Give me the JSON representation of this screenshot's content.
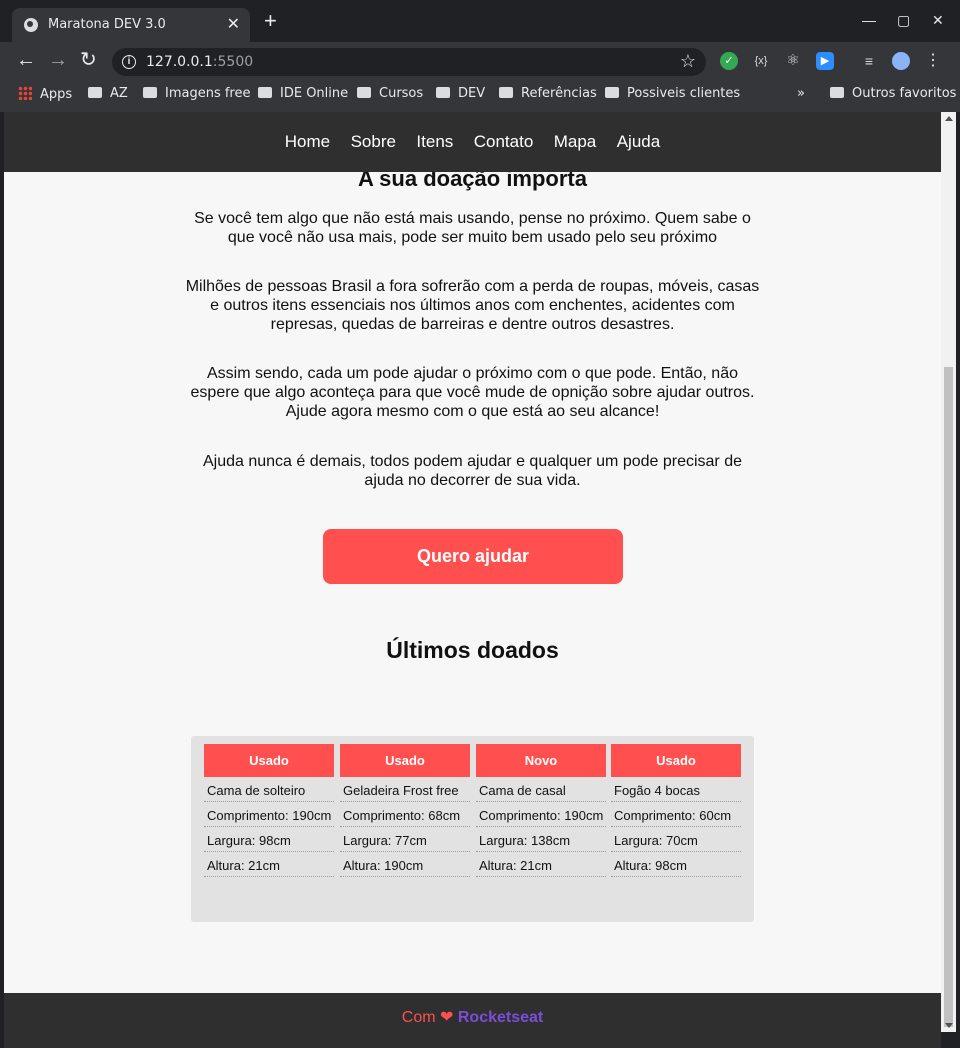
{
  "browser": {
    "tab_title": "Maratona DEV 3.0",
    "tab_close": "✕",
    "new_tab": "+",
    "window_controls": [
      "—",
      "▢",
      "✕"
    ],
    "url_host": "127.0.0.1",
    "url_port": ":5500",
    "bookmarks": [
      {
        "label": "Apps",
        "icon": "apps-icon"
      },
      {
        "label": "AZ",
        "icon": "folder-icon"
      },
      {
        "label": "Imagens free",
        "icon": "folder-icon"
      },
      {
        "label": "IDE Online",
        "icon": "folder-icon"
      },
      {
        "label": "Cursos",
        "icon": "folder-icon"
      },
      {
        "label": "DEV",
        "icon": "folder-icon"
      },
      {
        "label": "Referências",
        "icon": "folder-icon"
      },
      {
        "label": "Possiveis clientes",
        "icon": "folder-icon"
      }
    ],
    "more_bookmarks": "»",
    "other_bookmarks": "Outros favoritos"
  },
  "nav": {
    "items": [
      "Home",
      "Sobre",
      "Itens",
      "Contato",
      "Mapa",
      "Ajuda"
    ]
  },
  "main": {
    "title": "A sua doação importa",
    "paragraphs": [
      "Se você tem algo que não está mais usando, pense no próximo. Quem sabe o que você não usa mais, pode ser muito bem usado pelo seu próximo",
      "Milhões de pessoas Brasil a fora sofrerão com a perda de roupas, móveis, casas e outros itens essenciais nos últimos anos com enchentes, acidentes com represas, quedas de barreiras e dentre outros desastres.",
      "Assim sendo, cada um pode ajudar o próximo com o que pode. Então, não espere que algo aconteça para que você mude de opnição sobre ajudar outros. Ajude agora mesmo com o que está ao seu alcance!",
      "Ajuda nunca é demais, todos podem ajudar e qualquer um pode precisar de ajuda no decorrer de sua vida."
    ],
    "cta_label": "Quero ajudar",
    "donated_title": "Últimos doados"
  },
  "items": [
    {
      "condition": "Usado",
      "name": "Cama de solteiro",
      "comprimento": "Comprimento: 190cm",
      "largura": "Largura: 98cm",
      "altura": "Altura: 21cm"
    },
    {
      "condition": "Usado",
      "name": "Geladeira Frost free",
      "comprimento": "Comprimento: 68cm",
      "largura": "Largura: 77cm",
      "altura": "Altura: 190cm"
    },
    {
      "condition": "Novo",
      "name": "Cama de casal",
      "comprimento": "Comprimento: 190cm",
      "largura": "Largura: 138cm",
      "altura": "Altura: 21cm"
    },
    {
      "condition": "Usado",
      "name": "Fogão 4 bocas",
      "comprimento": "Comprimento: 60cm",
      "largura": "Largura: 70cm",
      "altura": "Altura: 98cm"
    }
  ],
  "footer": {
    "com": "Com",
    "heart": "❤",
    "brand": "Rocketseat"
  },
  "colors": {
    "accent": "#ff4f4f",
    "brand": "#7b4dd8",
    "header_bg": "#2f2f2f"
  }
}
